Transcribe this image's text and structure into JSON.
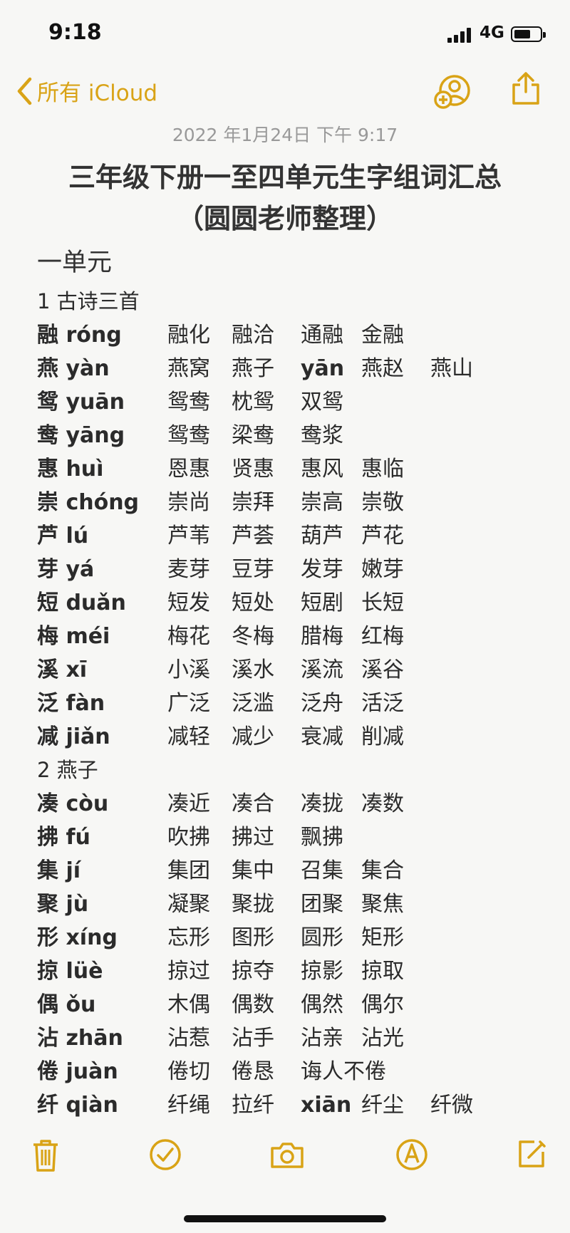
{
  "status": {
    "time": "9:18",
    "network": "4G"
  },
  "nav": {
    "back_label": "所有 iCloud"
  },
  "note": {
    "date": "2022 年1月24日 下午 9:17",
    "title_line1": "三年级下册一至四单元生字组词汇总",
    "title_line2": "（圆圆老师整理）",
    "unit": "一单元"
  },
  "lines": [
    {
      "type": "section",
      "text": "1 古诗三首"
    },
    {
      "char": "融",
      "py": "róng",
      "words": [
        "融化",
        "融洽",
        "通融",
        "金融"
      ]
    },
    {
      "char": "燕",
      "py": "yàn",
      "words": [
        "燕窝",
        "燕子",
        "yān",
        "燕赵",
        "燕山"
      ]
    },
    {
      "char": "鸳",
      "py": "yuān",
      "words": [
        "鸳鸯",
        "枕鸳",
        "双鸳"
      ]
    },
    {
      "char": "鸯",
      "py": "yāng",
      "words": [
        "鸳鸯",
        "梁鸯",
        "鸯浆"
      ]
    },
    {
      "char": "惠",
      "py": "huì",
      "words": [
        "恩惠",
        "贤惠",
        "惠风",
        "惠临"
      ]
    },
    {
      "char": "崇",
      "py": "chóng",
      "words": [
        "崇尚",
        "崇拜",
        "崇高",
        "崇敬"
      ]
    },
    {
      "char": "芦",
      "py": "lú",
      "words": [
        "芦苇",
        "芦荟",
        "葫芦",
        "芦花"
      ]
    },
    {
      "char": "芽",
      "py": "yá",
      "words": [
        "麦芽",
        "豆芽",
        "发芽",
        "嫩芽"
      ]
    },
    {
      "char": "短",
      "py": "duǎn",
      "words": [
        "短发",
        "短处",
        "短剧",
        "长短"
      ]
    },
    {
      "char": "梅",
      "py": "méi",
      "words": [
        "梅花",
        "冬梅",
        "腊梅",
        "红梅"
      ]
    },
    {
      "char": "溪",
      "py": "xī",
      "words": [
        "小溪",
        "溪水",
        "溪流",
        "溪谷"
      ]
    },
    {
      "char": "泛",
      "py": "fàn",
      "words": [
        "广泛",
        "泛滥",
        "泛舟",
        "活泛"
      ]
    },
    {
      "char": "减",
      "py": "jiǎn",
      "words": [
        "减轻",
        "减少",
        "衰减",
        "削减"
      ]
    },
    {
      "type": "section",
      "text": "2 燕子"
    },
    {
      "char": "凑",
      "py": "còu",
      "words": [
        "凑近",
        "凑合",
        "凑拢",
        "凑数"
      ]
    },
    {
      "char": "拂",
      "py": "fú",
      "words": [
        "吹拂",
        "拂过",
        "飘拂"
      ]
    },
    {
      "char": "集",
      "py": "jí",
      "words": [
        "集团",
        "集中",
        "召集",
        "集合"
      ]
    },
    {
      "char": "聚",
      "py": "jù",
      "words": [
        "凝聚",
        "聚拢",
        "团聚",
        "聚焦"
      ]
    },
    {
      "char": "形",
      "py": "xíng",
      "words": [
        "忘形",
        "图形",
        "圆形",
        "矩形"
      ]
    },
    {
      "char": "掠",
      "py": "lüè",
      "words": [
        "掠过",
        "掠夺",
        "掠影",
        "掠取"
      ]
    },
    {
      "char": "偶",
      "py": "ǒu",
      "words": [
        "木偶",
        "偶数",
        "偶然",
        "偶尔"
      ]
    },
    {
      "char": "沾",
      "py": "zhān",
      "words": [
        "沾惹",
        "沾手",
        "沾亲",
        "沾光"
      ]
    },
    {
      "char": "倦",
      "py": "juàn",
      "words": [
        "倦切",
        "倦恳",
        "诲人不倦"
      ]
    },
    {
      "char": "纤",
      "py": "qiàn",
      "words": [
        "纤绳",
        "拉纤",
        "xiān",
        "纤尘",
        "纤微"
      ]
    }
  ],
  "toolbar": {
    "delete_icon": "trash-icon",
    "checklist_icon": "checkmark-circle-icon",
    "camera_icon": "camera-icon",
    "markup_icon": "pen-circle-icon",
    "compose_icon": "compose-icon"
  },
  "colors": {
    "accent": "#d9a316",
    "background": "#f7f7f5",
    "text": "#2b2b2b",
    "date": "#999999"
  }
}
